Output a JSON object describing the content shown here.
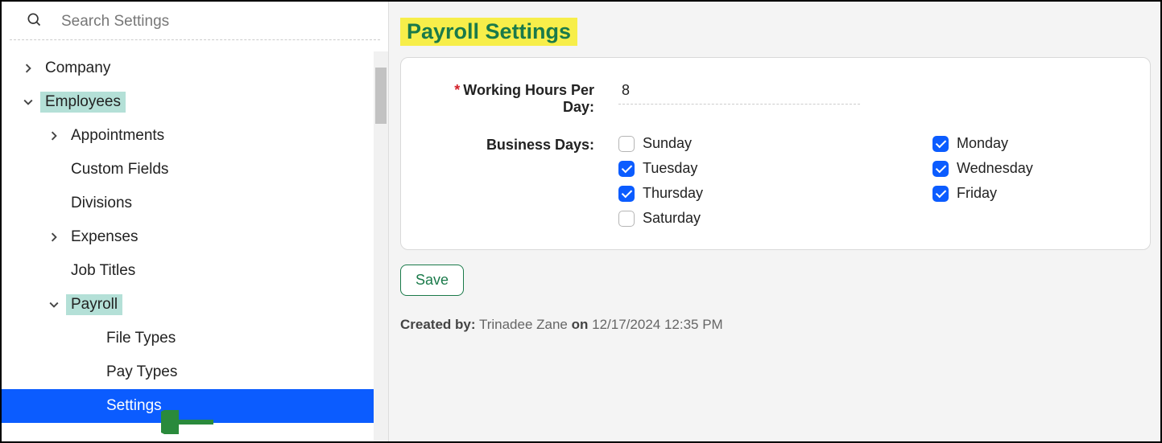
{
  "search": {
    "placeholder": "Search Settings"
  },
  "sidebar": {
    "items": [
      {
        "label": "Company",
        "depth": 0,
        "expanded": false,
        "hasChildren": true,
        "highlighted": false,
        "selected": false
      },
      {
        "label": "Employees",
        "depth": 0,
        "expanded": true,
        "hasChildren": true,
        "highlighted": true,
        "selected": false
      },
      {
        "label": "Appointments",
        "depth": 1,
        "expanded": false,
        "hasChildren": true,
        "highlighted": false,
        "selected": false
      },
      {
        "label": "Custom Fields",
        "depth": 1,
        "expanded": false,
        "hasChildren": false,
        "highlighted": false,
        "selected": false
      },
      {
        "label": "Divisions",
        "depth": 1,
        "expanded": false,
        "hasChildren": false,
        "highlighted": false,
        "selected": false
      },
      {
        "label": "Expenses",
        "depth": 1,
        "expanded": false,
        "hasChildren": true,
        "highlighted": false,
        "selected": false
      },
      {
        "label": "Job Titles",
        "depth": 1,
        "expanded": false,
        "hasChildren": false,
        "highlighted": false,
        "selected": false
      },
      {
        "label": "Payroll",
        "depth": 1,
        "expanded": true,
        "hasChildren": true,
        "highlighted": true,
        "selected": false
      },
      {
        "label": "File Types",
        "depth": 2,
        "expanded": false,
        "hasChildren": false,
        "highlighted": false,
        "selected": false
      },
      {
        "label": "Pay Types",
        "depth": 2,
        "expanded": false,
        "hasChildren": false,
        "highlighted": false,
        "selected": false
      },
      {
        "label": "Settings",
        "depth": 2,
        "expanded": false,
        "hasChildren": false,
        "highlighted": false,
        "selected": true
      }
    ]
  },
  "page": {
    "title": "Payroll Settings"
  },
  "form": {
    "working_hours": {
      "label": "Working Hours Per Day:",
      "value": "8",
      "required": true
    },
    "business_days": {
      "label": "Business Days:",
      "days": [
        {
          "label": "Sunday",
          "checked": false
        },
        {
          "label": "Monday",
          "checked": true
        },
        {
          "label": "Tuesday",
          "checked": true
        },
        {
          "label": "Wednesday",
          "checked": true
        },
        {
          "label": "Thursday",
          "checked": true
        },
        {
          "label": "Friday",
          "checked": true
        },
        {
          "label": "Saturday",
          "checked": false
        }
      ]
    }
  },
  "actions": {
    "save": "Save"
  },
  "meta": {
    "created_by_label": "Created by:",
    "created_by_value": "Trinadee Zane",
    "on_label": "on",
    "created_on": "12/17/2024 12:35 PM"
  }
}
